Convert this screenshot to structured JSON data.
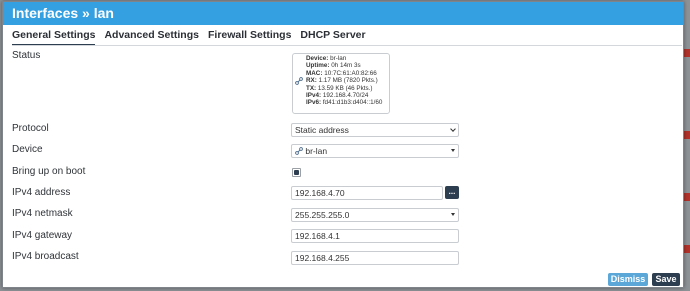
{
  "dialog": {
    "title": "Interfaces » lan",
    "tabs": [
      {
        "label": "General Settings",
        "active": true
      },
      {
        "label": "Advanced Settings",
        "active": false
      },
      {
        "label": "Firewall Settings",
        "active": false
      },
      {
        "label": "DHCP Server",
        "active": false
      }
    ]
  },
  "status": {
    "label": "Status",
    "device_key": "Device:",
    "device_val": "br-lan",
    "uptime_key": "Uptime:",
    "uptime_val": "0h 14m 3s",
    "mac_key": "MAC:",
    "mac_val": "10:7C:61:A0:82:66",
    "rx_key": "RX:",
    "rx_val": "1.17 MB (7820 Pkts.)",
    "tx_key": "TX:",
    "tx_val": "13.59 KB (46 Pkts.)",
    "ipv4_key": "IPv4:",
    "ipv4_val": "192.168.4.70/24",
    "ipv6_key": "IPv6:",
    "ipv6_val": "fd41:d1b3:d404::1/60"
  },
  "form": {
    "protocol_label": "Protocol",
    "protocol_value": "Static address",
    "device_label": "Device",
    "device_value": "br-lan",
    "boot_label": "Bring up on boot",
    "boot_checked": true,
    "ipv4_address_label": "IPv4 address",
    "ipv4_address_value": "192.168.4.70",
    "more_button_label": "...",
    "ipv4_netmask_label": "IPv4 netmask",
    "ipv4_netmask_value": "255.255.255.0",
    "ipv4_gateway_label": "IPv4 gateway",
    "ipv4_gateway_value": "192.168.4.1",
    "ipv4_broadcast_label": "IPv4 broadcast",
    "ipv4_broadcast_value": "192.168.4.255"
  },
  "footer": {
    "dismiss_label": "Dismiss",
    "save_label": "Save"
  },
  "colors": {
    "titlebar": "#35a0e1",
    "primary": "#2d3e50",
    "dismiss": "#5aa7d8"
  }
}
